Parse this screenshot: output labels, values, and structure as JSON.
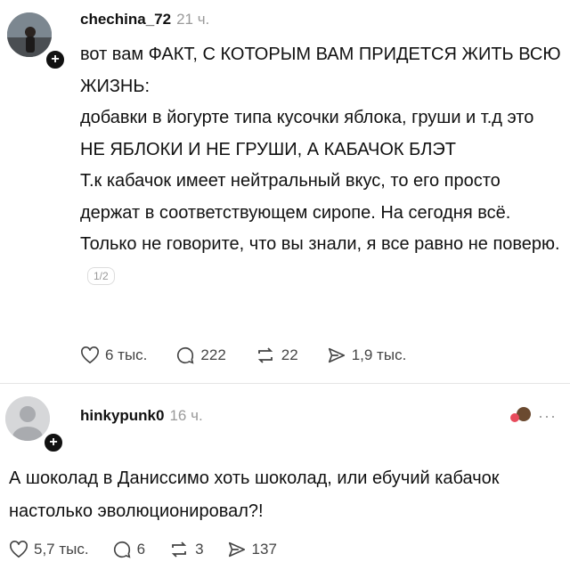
{
  "post1": {
    "username": "chechina_72",
    "time": "21 ч.",
    "paragraphs": [
      "вот вам ФАКТ, С КОТОРЫМ ВАМ ПРИДЕТСЯ ЖИТЬ ВСЮ ЖИЗНЬ:",
      "добавки в йогурте типа кусочки яблока, груши и т.д это НЕ ЯБЛОКИ И НЕ ГРУШИ, А КАБАЧОК БЛЭТ",
      "Т.к кабачок имеет нейтральный вкус, то его просто держат в соответствующем сиропе. На сегодня всё. Только не говорите, что вы знали, я все равно не поверю."
    ],
    "pager": "1/2",
    "likes": "6 тыс.",
    "comments": "222",
    "reposts": "22",
    "shares": "1,9 тыс."
  },
  "post2": {
    "username": "hinkypunk0",
    "time": "16 ч.",
    "text": "А шоколад в Даниссимо хоть шоколад, или ебучий кабачок настолько эволюционировал?!",
    "more": "···",
    "likes": "5,7 тыс.",
    "comments": "6",
    "reposts": "3",
    "shares": "137"
  },
  "icons": [
    "heart-icon",
    "comment-icon",
    "repost-icon",
    "share-icon",
    "plus-icon",
    "more-icon"
  ]
}
